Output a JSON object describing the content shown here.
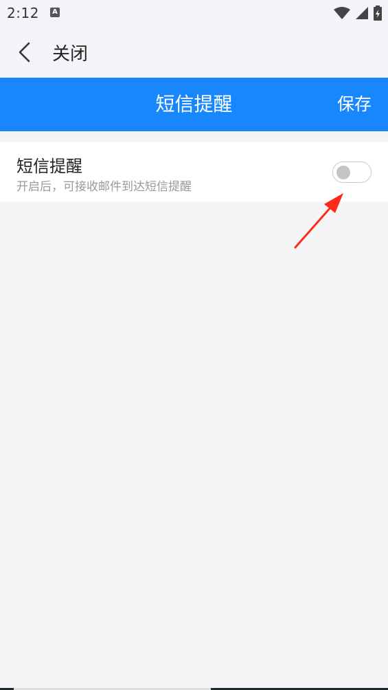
{
  "status_bar": {
    "time": "2:12",
    "notification_icon": "A",
    "icons": [
      "wifi-icon",
      "signal-icon",
      "battery-icon"
    ]
  },
  "topbar": {
    "back_icon": "chevron-left-icon",
    "close_label": "关闭"
  },
  "header": {
    "title": "短信提醒",
    "save_label": "保存",
    "accent_color": "#1787fb"
  },
  "setting": {
    "title": "短信提醒",
    "description": "开启后，可接收邮件到达短信提醒",
    "toggle_on": false
  },
  "annotation": {
    "arrow_color": "#ff2a1a"
  }
}
